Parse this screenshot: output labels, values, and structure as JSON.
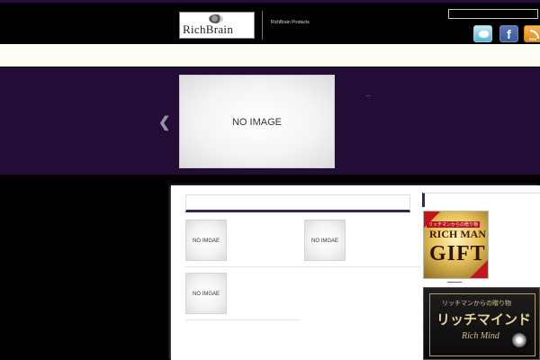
{
  "header": {
    "logo_text": "RichBrain",
    "tagline": "RichBrain Products",
    "search": {
      "value": "",
      "placeholder": ""
    },
    "social": {
      "facebook_glyph": "f",
      "rss_label": "RSS"
    }
  },
  "slider": {
    "image_label": "NO IMAGE",
    "prev_glyph": "❮",
    "pager_text": "..."
  },
  "content": {
    "thumbs": [
      {
        "label": "NO IMGAE"
      },
      {
        "label": "NO IMGAE"
      },
      {
        "label": "NO IMGAE"
      }
    ]
  },
  "sidebar": {
    "gift_banner": {
      "subtitle": "リッチマンからの贈り物",
      "title": "RICH MAN",
      "big": "GIFT"
    },
    "mind_banner": {
      "subtitle": "リッチマンからの贈り物",
      "title": "リッチマインド",
      "script": "Rich Mind"
    }
  },
  "colors": {
    "accent_purple": "#3b1f55",
    "slider_bg": "#230c36",
    "nav_bg": "#fdfcf2"
  }
}
